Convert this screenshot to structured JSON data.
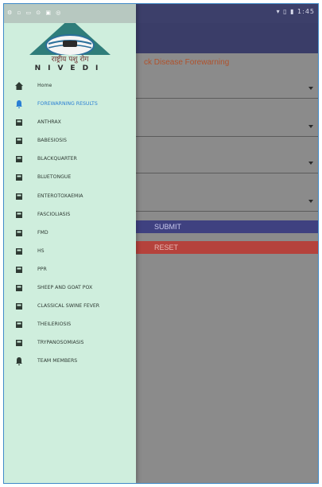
{
  "status_bar": {
    "left_icons": "⚙ ▫ ▭ ⊙ ▣ ◎",
    "right_text": "▾ ▯ ▮ 1:45"
  },
  "header": {
    "logo_devanagari": "राष्ट्रीय पशु रोग",
    "logo_latin": "NIVEDI"
  },
  "app": {
    "title_partial": "ck Disease Forewarning"
  },
  "buttons": {
    "submit": "SUBMIT",
    "reset": "RESET"
  },
  "colors": {
    "drawer_bg": "#cfeedd",
    "toolbar": "#3a3d68",
    "active": "#2a7fd4",
    "submit": "#3f4180",
    "reset": "#b5423c",
    "title": "#b0522c"
  },
  "menu": {
    "items": [
      {
        "label": "Home",
        "icon": "home-icon"
      },
      {
        "label": "FOREWARNING RESULTS",
        "icon": "bell-icon",
        "active": true
      },
      {
        "label": "ANTHRAX",
        "icon": "book-icon"
      },
      {
        "label": "BABESIOSIS",
        "icon": "book-icon"
      },
      {
        "label": "BLACKQUARTER",
        "icon": "book-icon"
      },
      {
        "label": "BLUETONGUE",
        "icon": "book-icon"
      },
      {
        "label": "ENTEROTOXAEMIA",
        "icon": "book-icon"
      },
      {
        "label": "FASCIOLIASIS",
        "icon": "book-icon"
      },
      {
        "label": "FMD",
        "icon": "book-icon"
      },
      {
        "label": "HS",
        "icon": "book-icon"
      },
      {
        "label": "PPR",
        "icon": "book-icon"
      },
      {
        "label": "SHEEP AND GOAT POX",
        "icon": "book-icon"
      },
      {
        "label": "CLASSICAL SWINE FEVER",
        "icon": "book-icon"
      },
      {
        "label": "THEILERIOSIS",
        "icon": "book-icon"
      },
      {
        "label": "TRYPANOSOMIASIS",
        "icon": "book-icon"
      },
      {
        "label": "TEAM MEMBERS",
        "icon": "bell-icon"
      }
    ]
  }
}
